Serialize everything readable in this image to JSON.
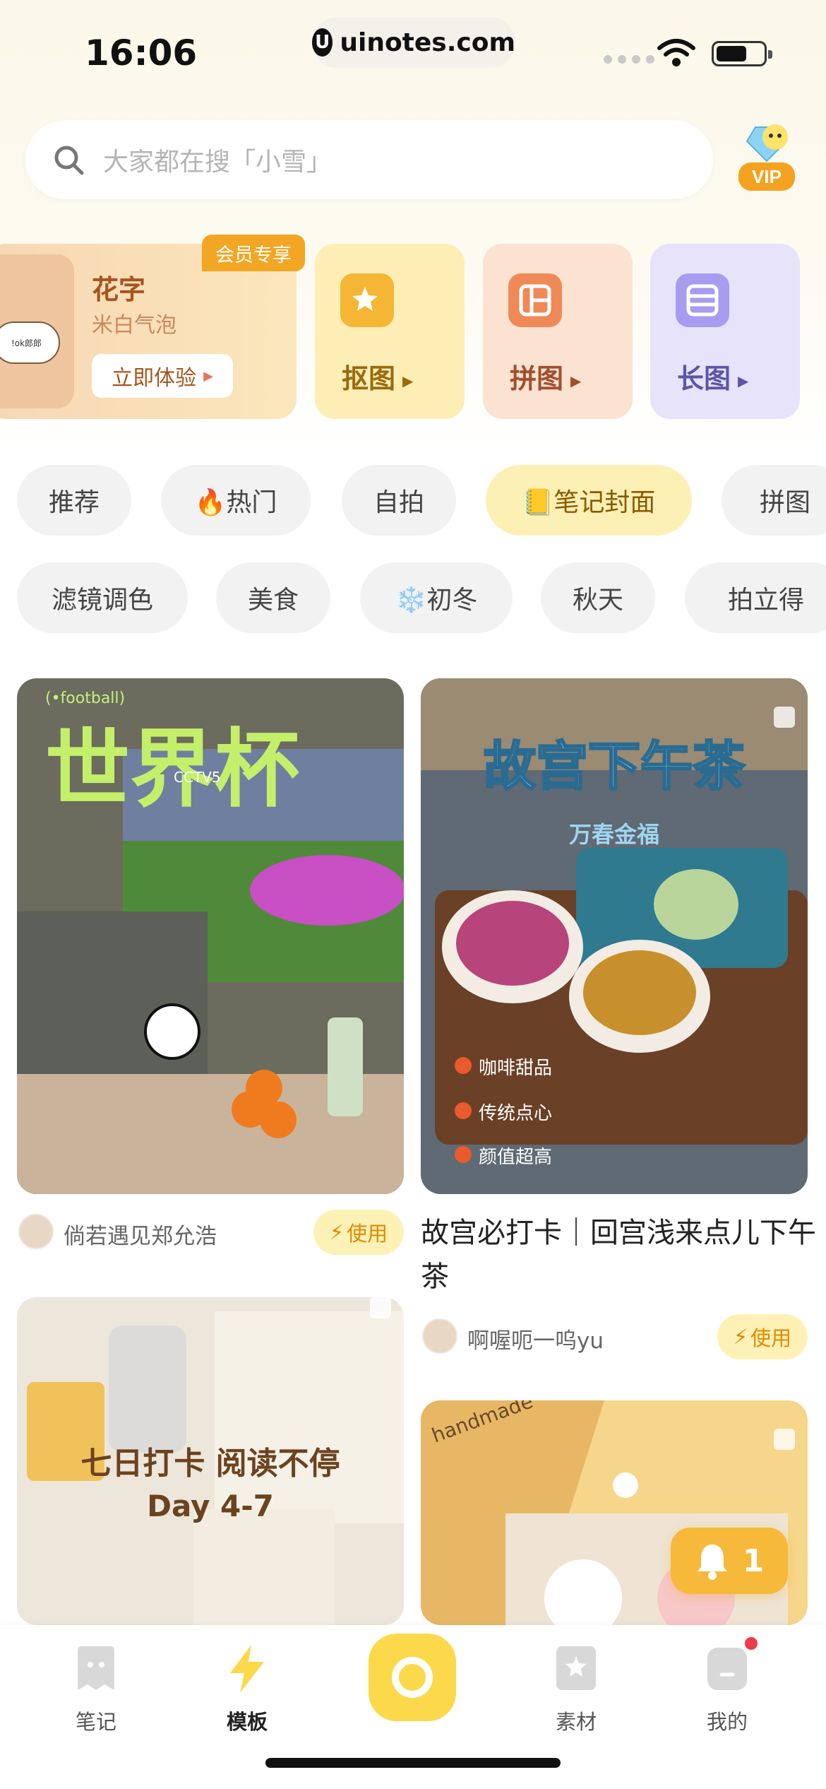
{
  "status_bar": {
    "time": "16:06",
    "url": "uinotes.com"
  },
  "search": {
    "placeholder": "大家都在搜「小雪」",
    "vip_label": "VIP"
  },
  "features": {
    "main": {
      "badge": "会员专享",
      "title": "花字",
      "subtitle": "米白气泡",
      "button": "立即体验",
      "bubble_text": "!ok郎郎"
    },
    "tiles": [
      {
        "label": "抠图",
        "icon": "star-wand-icon"
      },
      {
        "label": "拼图",
        "icon": "collage-icon"
      },
      {
        "label": "长图",
        "icon": "long-image-icon"
      }
    ]
  },
  "chips_row1": [
    "推荐",
    "🔥热门",
    "自拍",
    "📒笔记封面",
    "拼图"
  ],
  "chips_row2": [
    "滤镜调色",
    "美食",
    "❄️初冬",
    "秋天",
    "拍立得"
  ],
  "active_chip": "📒笔记封面",
  "feed": {
    "left": [
      {
        "image_text": {
          "tag": "(•football)",
          "headline": "世界杯",
          "channel": "CCTV5"
        },
        "author": "倘若遇见郑允浩",
        "use_label": "使用"
      },
      {
        "image_text": {
          "headline": "七日打卡 阅读不停",
          "sub": "Day 4-7"
        }
      }
    ],
    "right": [
      {
        "image_text": {
          "headline": "故宫下午茶",
          "sub": "万春金福",
          "bullets": [
            "咖啡甜品",
            "传统点心",
            "颜值超高"
          ]
        },
        "title": "故宫必打卡｜回宫浅来点儿下午茶",
        "author": "啊喔呃一呜yu",
        "use_label": "使用"
      },
      {
        "image_text": {
          "brand": "handmade"
        }
      }
    ]
  },
  "notification": {
    "count": "1"
  },
  "tabbar": [
    {
      "label": "笔记",
      "icon": "note-ghost-icon",
      "active": false
    },
    {
      "label": "模板",
      "icon": "lightning-icon",
      "active": true
    },
    {
      "label": "",
      "icon": "camera-icon",
      "active": false
    },
    {
      "label": "素材",
      "icon": "material-star-icon",
      "active": false
    },
    {
      "label": "我的",
      "icon": "profile-icon",
      "active": false
    }
  ],
  "colors": {
    "accent": "#fbd94a",
    "chip_active_bg": "#fdf0b4",
    "use_text": "#e08a00",
    "badge_red": "#ef3a4b"
  }
}
